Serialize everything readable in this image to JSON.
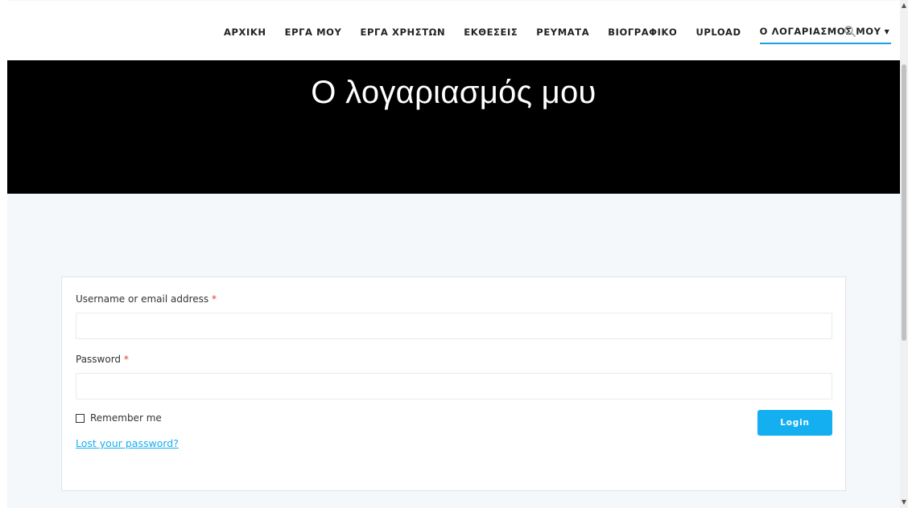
{
  "nav": {
    "items": [
      {
        "label": "ΑΡΧΙΚΗ"
      },
      {
        "label": "ΕΡΓΑ ΜΟΥ"
      },
      {
        "label": "ΕΡΓΑ ΧΡΗΣΤΩΝ"
      },
      {
        "label": "ΕΚΘΕΣΕΙΣ"
      },
      {
        "label": "ΡΕΥΜΑΤΑ"
      },
      {
        "label": "ΒΙΟΓΡΑΦΙΚΟ"
      },
      {
        "label": "UPLOAD"
      },
      {
        "label": "Ο ΛΟΓΑΡΙΑΣΜΟΣ ΜΟΥ"
      }
    ],
    "active_index": 7,
    "search_icon": "search-icon"
  },
  "hero": {
    "title": "Ο λογαριασμός μου"
  },
  "login": {
    "username_label": "Username or email address",
    "username_value": "",
    "password_label": "Password",
    "password_value": "",
    "required_marker": "*",
    "remember_label": "Remember me",
    "remember_checked": false,
    "button_label": "Login",
    "lost_password_link": "Lost your password?"
  },
  "colors": {
    "accent": "#13aff0",
    "nav_underline": "#1a9fe0",
    "required": "#e2401c",
    "hero_bg": "#000000",
    "page_bg": "#f4f8fb"
  }
}
